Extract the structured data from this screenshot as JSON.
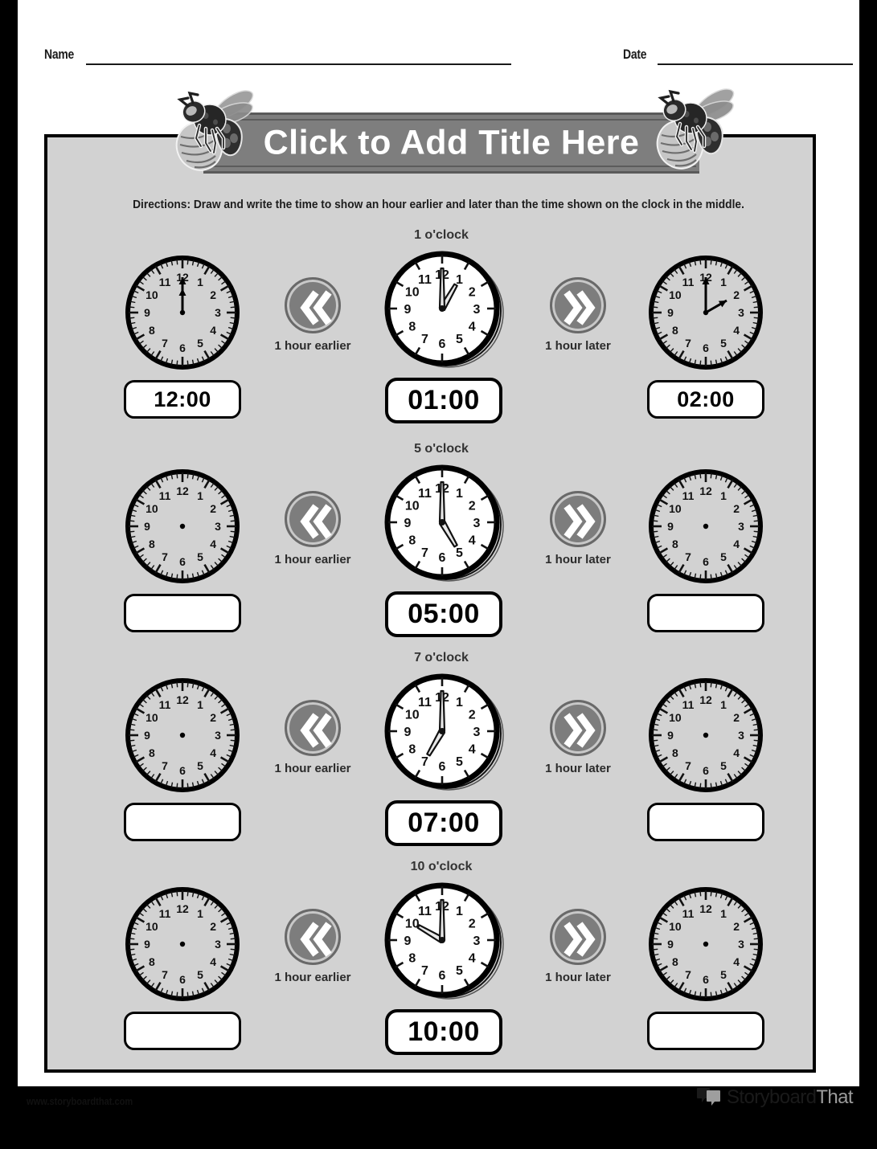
{
  "header": {
    "name_label": "Name",
    "date_label": "Date"
  },
  "title": {
    "text": "Click to Add Title Here"
  },
  "directions": {
    "text": "Directions: Draw and write the time to show an hour earlier and later than the time shown on the clock in the middle."
  },
  "nav": {
    "earlier_label": "1 hour earlier",
    "later_label": "1 hour later",
    "earlier_icon": "double-chevron-left-icon",
    "later_icon": "double-chevron-right-icon"
  },
  "colors": {
    "panel_bg": "#d2d2d2",
    "banner_bg": "#7e7e7e",
    "nav_circle": "#7d7d7d",
    "page_border": "#000000"
  },
  "rows": [
    {
      "middle_caption": "1 o'clock",
      "left": {
        "answer": "12:00",
        "hour": 12,
        "minute": 0,
        "has_hands": true
      },
      "middle": {
        "answer": "01:00",
        "hour": 1,
        "minute": 0,
        "has_hands": true
      },
      "right": {
        "answer": "02:00",
        "hour": 2,
        "minute": 0,
        "has_hands": true
      }
    },
    {
      "middle_caption": "5 o'clock",
      "left": {
        "answer": "",
        "hour": null,
        "minute": null,
        "has_hands": false
      },
      "middle": {
        "answer": "05:00",
        "hour": 5,
        "minute": 0,
        "has_hands": true
      },
      "right": {
        "answer": "",
        "hour": null,
        "minute": null,
        "has_hands": false
      }
    },
    {
      "middle_caption": "7 o'clock",
      "left": {
        "answer": "",
        "hour": null,
        "minute": null,
        "has_hands": false
      },
      "middle": {
        "answer": "07:00",
        "hour": 7,
        "minute": 0,
        "has_hands": true
      },
      "right": {
        "answer": "",
        "hour": null,
        "minute": null,
        "has_hands": false
      }
    },
    {
      "middle_caption": "10 o'clock",
      "left": {
        "answer": "",
        "hour": null,
        "minute": null,
        "has_hands": false
      },
      "middle": {
        "answer": "10:00",
        "hour": 10,
        "minute": 0,
        "has_hands": true
      },
      "right": {
        "answer": "",
        "hour": null,
        "minute": null,
        "has_hands": false
      }
    }
  ],
  "clock_numerals": [
    "12",
    "1",
    "2",
    "3",
    "4",
    "5",
    "6",
    "7",
    "8",
    "9",
    "10",
    "11"
  ],
  "footer": {
    "url": "www.storyboardthat.com",
    "logo_primary": "Storyboard",
    "logo_secondary": "That"
  }
}
